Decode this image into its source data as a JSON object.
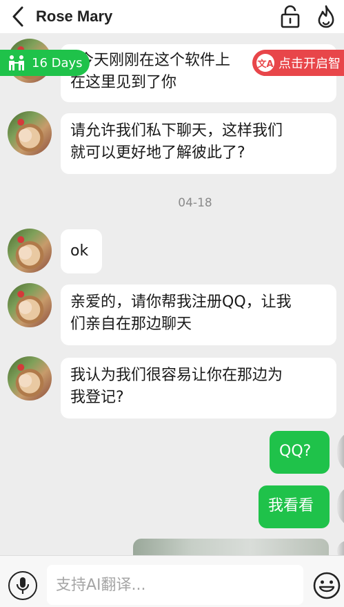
{
  "header": {
    "title": "Rose Mary",
    "icons": [
      "back-arrow-icon",
      "lock-icon",
      "flame-icon"
    ]
  },
  "badges": {
    "days": "16 Days",
    "translate": "点击开启智"
  },
  "messages": [
    {
      "side": "left",
      "text_line1": "今天刚刚在这个软件上",
      "text_line2": "在这里见到了你"
    },
    {
      "side": "left",
      "text_line1": "请允许我们私下聊天，这样我们",
      "text_line2": "就可以更好地了解彼此了?"
    },
    {
      "side": "center",
      "text": "04-18"
    },
    {
      "side": "left",
      "text": "ok"
    },
    {
      "side": "left",
      "text_line1": "亲爱的，请你帮我注册QQ，让我",
      "text_line2": "们亲自在那边聊天"
    },
    {
      "side": "left",
      "text_line1": "我认为我们很容易让你在那边为",
      "text_line2": "我登记?"
    },
    {
      "side": "right",
      "text": "QQ?"
    },
    {
      "side": "right",
      "text": "我看看"
    }
  ],
  "input": {
    "placeholder": "支持AI翻译..."
  },
  "colors": {
    "accent_green": "#1fc24a",
    "translate_red": "#e8464a",
    "background": "#ededed"
  }
}
